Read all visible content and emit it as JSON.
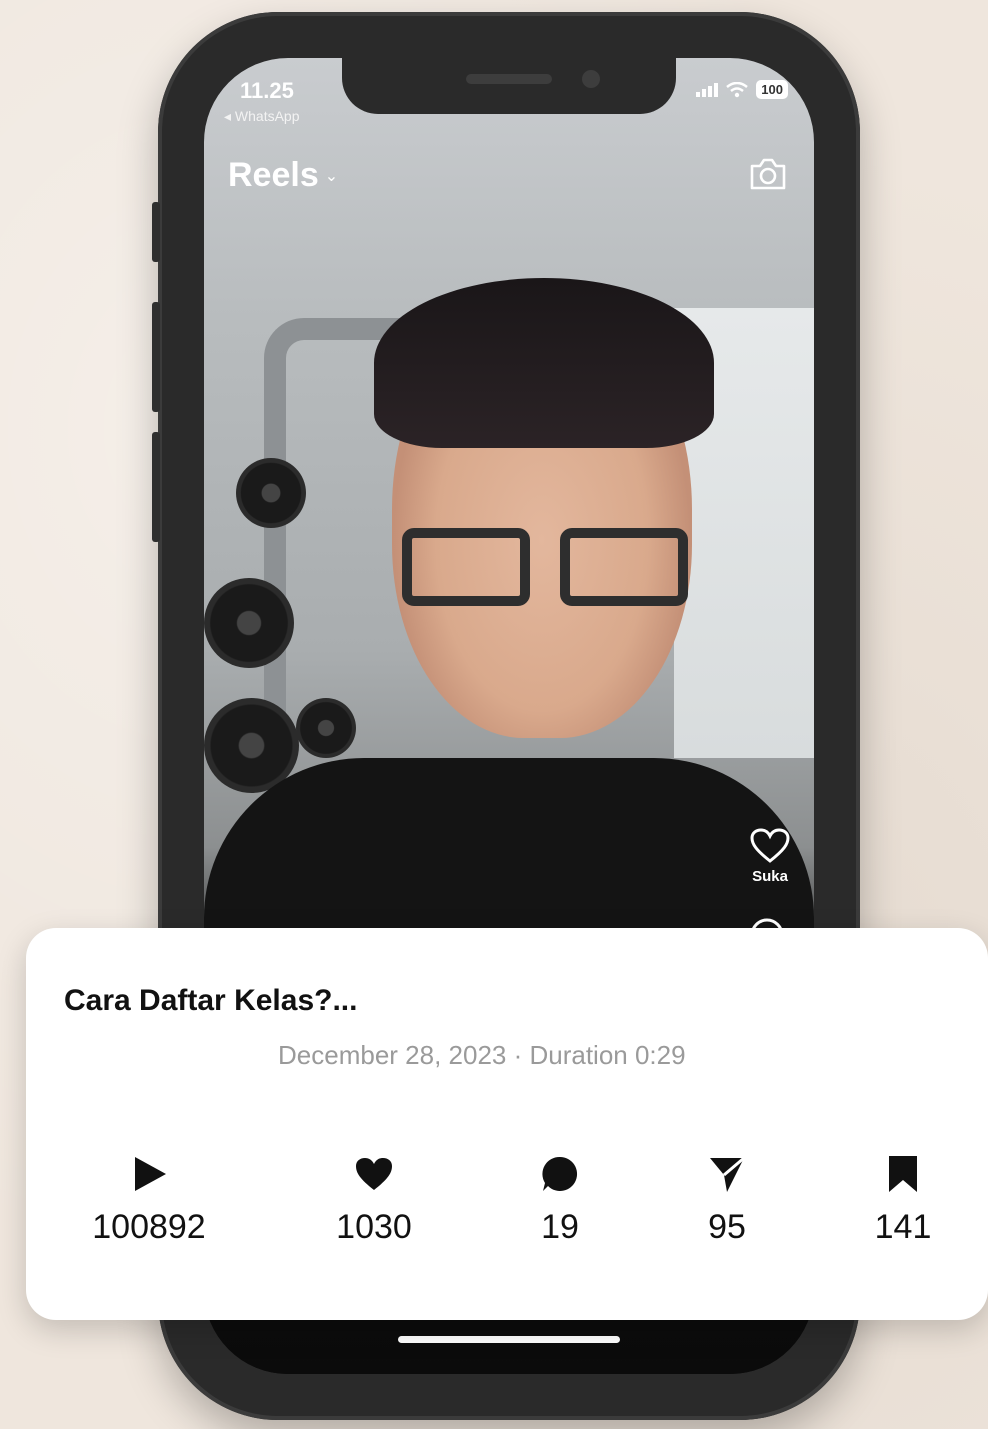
{
  "status_bar": {
    "time": "11.25",
    "back_label": "◂ WhatsApp",
    "battery": "100"
  },
  "header": {
    "title": "Reels",
    "dropdown_icon": "chevron-down-icon",
    "camera_icon": "camera-icon"
  },
  "actions": {
    "like_label": "Suka",
    "like_icon": "heart-outline-icon",
    "comment_icon": "comment-icon"
  },
  "post_card": {
    "title": "Cara Daftar Kelas?...",
    "meta": "December 28, 2023 · Duration 0:29",
    "stats": [
      {
        "icon": "play-icon",
        "value": "100892"
      },
      {
        "icon": "heart-icon",
        "value": "1030"
      },
      {
        "icon": "comment-icon",
        "value": "19"
      },
      {
        "icon": "share-icon",
        "value": "95"
      },
      {
        "icon": "bookmark-icon",
        "value": "141"
      }
    ]
  },
  "colors": {
    "background": "#efe6dd",
    "phone_frame": "#2a2a2a",
    "card": "#ffffff",
    "meta_text": "#9a9a9a"
  }
}
